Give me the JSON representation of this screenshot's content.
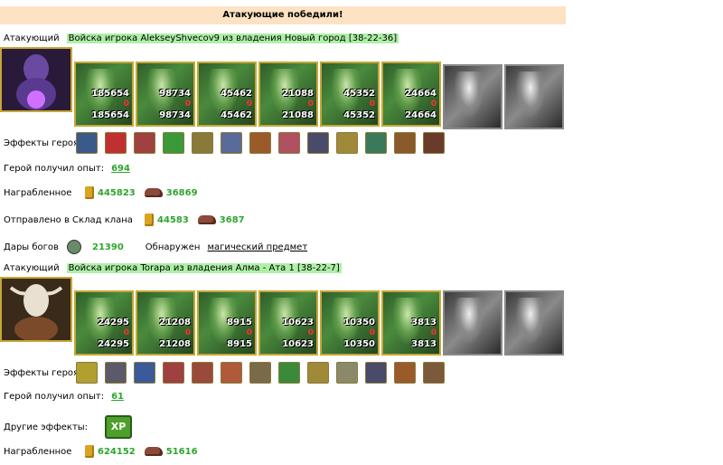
{
  "banner": "Атакующие победили!",
  "attackers": [
    {
      "label": "Атакующий",
      "name": "Войска игрока AlekseyShvecov9 из владения Новый город [38-22-36]",
      "units": [
        {
          "top": "185654",
          "mid": "0",
          "bot": "185654"
        },
        {
          "top": "98734",
          "mid": "0",
          "bot": "98734"
        },
        {
          "top": "45462",
          "mid": "0",
          "bot": "45462"
        },
        {
          "top": "21088",
          "mid": "0",
          "bot": "21088"
        },
        {
          "top": "45352",
          "mid": "0",
          "bot": "45352"
        },
        {
          "top": "24664",
          "mid": "0",
          "bot": "24664"
        }
      ],
      "effects_label": "Эффекты героя:",
      "effects_count": 13,
      "exp_label": "Герой получил опыт:",
      "exp": "694",
      "loot_label": "Награбленное",
      "loot_gold": "445823",
      "loot_ore": "36869",
      "clan_label": "Отправлено в Склад клана",
      "clan_gold": "44583",
      "clan_ore": "3687",
      "gifts_label": "Дары богов",
      "gifts": "21390",
      "found_label": "Обнаружен",
      "found": "магический предмет"
    },
    {
      "label": "Атакующий",
      "name": "Войска игрока Torapa  из владения Алма - Ата 1 [38-22-7]",
      "units": [
        {
          "top": "24295",
          "mid": "0",
          "bot": "24295"
        },
        {
          "top": "21208",
          "mid": "0",
          "bot": "21208"
        },
        {
          "top": "8915",
          "mid": "0",
          "bot": "8915"
        },
        {
          "top": "10623",
          "mid": "0",
          "bot": "10623"
        },
        {
          "top": "10350",
          "mid": "0",
          "bot": "10350"
        },
        {
          "top": "3813",
          "mid": "0",
          "bot": "3813"
        }
      ],
      "effects_label": "Эффекты героя:",
      "effects_count": 13,
      "exp_label": "Герой получил опыт:",
      "exp": "61",
      "other_label": "Другие эффекты:",
      "other_icon": "XP",
      "loot_label": "Награбленное",
      "loot_gold": "624152",
      "loot_ore": "51616"
    }
  ]
}
